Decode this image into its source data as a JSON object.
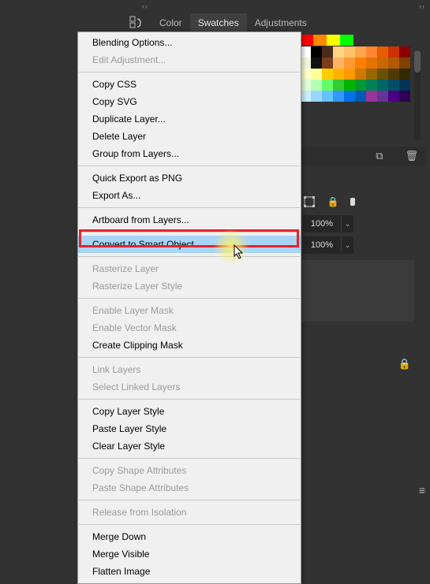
{
  "tabs": {
    "color": "Color",
    "swatches": "Swatches",
    "adjustments": "Adjustments"
  },
  "swatches": {
    "row1": [
      "#ff0000",
      "#ff8800",
      "#ffff00",
      "#00ff00"
    ],
    "grid": [
      "#ffffff",
      "#000000",
      "#4a2b1a",
      "#ffd480",
      "#ffc266",
      "#ffa64d",
      "#ff8533",
      "#e65c00",
      "#cc3300",
      "#8b0000",
      "#f5f5dc",
      "#111111",
      "#7a3e1e",
      "#ffb366",
      "#ff9933",
      "#ff8000",
      "#e67300",
      "#cc6600",
      "#b35900",
      "#804000",
      "#ffffcc",
      "#ffff99",
      "#ffcc00",
      "#ffb300",
      "#ff9900",
      "#cc7a00",
      "#996600",
      "#665200",
      "#4d3b00",
      "#332900",
      "#e0ffd6",
      "#b3ffb3",
      "#66ff66",
      "#33cc33",
      "#00b300",
      "#009933",
      "#008055",
      "#006666",
      "#004d66",
      "#003355",
      "#cceeff",
      "#99d6ff",
      "#66c2ff",
      "#3399ff",
      "#0073e6",
      "#0059b3",
      "#993399",
      "#663399",
      "#4b0082",
      "#2e0054"
    ]
  },
  "panel_footer": {
    "new_swatch": "⧉",
    "delete": "🗑"
  },
  "right_props": {
    "bounds_icon": "◻",
    "lock_icon": "🔒",
    "marker": "●"
  },
  "percent_rows": {
    "opacity": "100%",
    "fill": "100%",
    "chevron": "⌄"
  },
  "lock": "🔒",
  "hamburger": "≡",
  "context_menu": {
    "items": [
      {
        "label": "Blending Options...",
        "enabled": true
      },
      {
        "label": "Edit Adjustment...",
        "enabled": false
      },
      {
        "sep": true
      },
      {
        "label": "Copy CSS",
        "enabled": true
      },
      {
        "label": "Copy SVG",
        "enabled": true
      },
      {
        "label": "Duplicate Layer...",
        "enabled": true
      },
      {
        "label": "Delete Layer",
        "enabled": true
      },
      {
        "label": "Group from Layers...",
        "enabled": true
      },
      {
        "sep": true
      },
      {
        "label": "Quick Export as PNG",
        "enabled": true
      },
      {
        "label": "Export As...",
        "enabled": true
      },
      {
        "sep": true
      },
      {
        "label": "Artboard from Layers...",
        "enabled": true
      },
      {
        "sep": true
      },
      {
        "label": "Convert to Smart Object",
        "enabled": true,
        "highlighted": true
      },
      {
        "sep": true
      },
      {
        "label": "Rasterize Layer",
        "enabled": false
      },
      {
        "label": "Rasterize Layer Style",
        "enabled": false
      },
      {
        "sep": true
      },
      {
        "label": "Enable Layer Mask",
        "enabled": false
      },
      {
        "label": "Enable Vector Mask",
        "enabled": false
      },
      {
        "label": "Create Clipping Mask",
        "enabled": true
      },
      {
        "sep": true
      },
      {
        "label": "Link Layers",
        "enabled": false
      },
      {
        "label": "Select Linked Layers",
        "enabled": false
      },
      {
        "sep": true
      },
      {
        "label": "Copy Layer Style",
        "enabled": true
      },
      {
        "label": "Paste Layer Style",
        "enabled": true
      },
      {
        "label": "Clear Layer Style",
        "enabled": true
      },
      {
        "sep": true
      },
      {
        "label": "Copy Shape Attributes",
        "enabled": false
      },
      {
        "label": "Paste Shape Attributes",
        "enabled": false
      },
      {
        "sep": true
      },
      {
        "label": "Release from Isolation",
        "enabled": false
      },
      {
        "sep": true
      },
      {
        "label": "Merge Down",
        "enabled": true
      },
      {
        "label": "Merge Visible",
        "enabled": true
      },
      {
        "label": "Flatten Image",
        "enabled": true
      }
    ]
  }
}
